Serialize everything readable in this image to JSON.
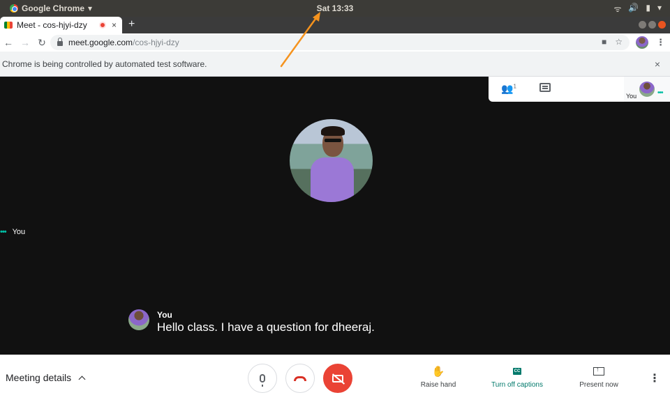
{
  "system_bar": {
    "app_name": "Google Chrome",
    "app_menu_arrow": "▾",
    "clock": "Sat 13:33",
    "tray_icons": [
      "wifi-icon",
      "volume-icon",
      "battery-icon",
      "menu-arrow-icon"
    ]
  },
  "browser": {
    "tab_title": "Meet - cos-hjyi-dzy",
    "tab_close": "×",
    "new_tab": "+",
    "url_host": "meet.google.com",
    "url_path": "/cos-hjyi-dzy",
    "infobar_text": "Chrome is being controlled by automated test software.",
    "infobar_close": "×"
  },
  "meet": {
    "participants_count": "1",
    "self_tile_label": "You",
    "presenter_name": "You",
    "caption_speaker": "You",
    "caption_text": "Hello class. I have a question for dheeraj.",
    "meeting_details_label": "Meeting details",
    "raise_hand_label": "Raise hand",
    "captions_label": "Turn off captions",
    "captions_icon_text": "CC",
    "present_label": "Present now",
    "accent_color": "#00796b",
    "hangup_color": "#d93025",
    "camera_off_color": "#ea4335"
  }
}
